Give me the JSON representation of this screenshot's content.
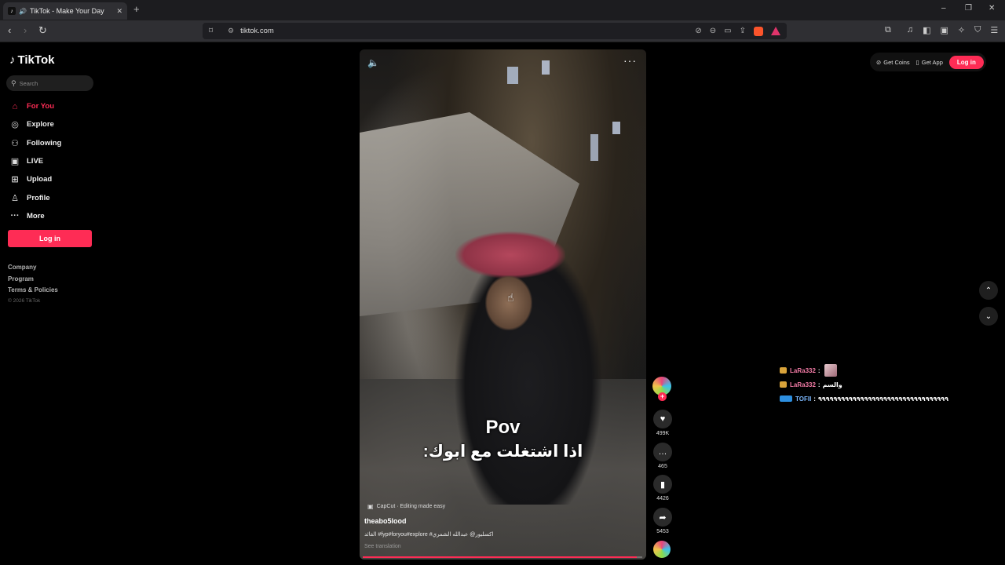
{
  "browser": {
    "tab_title": "TikTok - Make Your Day",
    "new_tab": "+",
    "url": "tiktok.com",
    "window_controls": [
      "–",
      "❐",
      "✕"
    ]
  },
  "sidebar": {
    "logo": "TikTok",
    "search_placeholder": "Search",
    "items": [
      {
        "label": "For You",
        "icon": "home-icon",
        "active": true
      },
      {
        "label": "Explore",
        "icon": "compass-icon",
        "active": false
      },
      {
        "label": "Following",
        "icon": "user-follow-icon",
        "active": false
      },
      {
        "label": "LIVE",
        "icon": "live-icon",
        "active": false
      },
      {
        "label": "Upload",
        "icon": "upload-icon",
        "active": false
      },
      {
        "label": "Profile",
        "icon": "profile-icon",
        "active": false
      },
      {
        "label": "More",
        "icon": "more-icon",
        "active": false
      }
    ],
    "login_button": "Log in",
    "footer": [
      "Company",
      "Program",
      "Terms & Policies"
    ],
    "copyright": "© 2026 TikTok"
  },
  "video": {
    "overlay_title": "Pov",
    "overlay_arabic": "اذا اشتغلت مع ابوك:",
    "capcut_label": "CapCut · Editing made easy",
    "username": "theabo5lood",
    "caption": "القائد #fyp#foryou#explore #اكسلبور@ عبدالله الشمري",
    "see_translation": "See translation",
    "progress": 0.98
  },
  "actions": {
    "likes": "499K",
    "comments": "465",
    "saves": "4426",
    "shares": "5453"
  },
  "topbar": {
    "get_coins": "Get Coins",
    "get_app": "Get App",
    "login": "Log in"
  },
  "live_comments": [
    {
      "name": "LaRa332",
      "message": "",
      "has_sticker": true,
      "badge": "gold"
    },
    {
      "name": "LaRa332",
      "message": "والسم",
      "has_sticker": false,
      "badge": "gold"
    },
    {
      "name": "TOFII",
      "message": "٩٩٩٩٩٩٩٩٩٩٩٩٩٩٩٩٩٩٩٩٩٩٩٩٩٩٩٩٩٩٩٩٩٩",
      "has_sticker": false,
      "badge": "blue"
    }
  ],
  "colors": {
    "accent": "#fe2c55",
    "background": "#000000"
  }
}
